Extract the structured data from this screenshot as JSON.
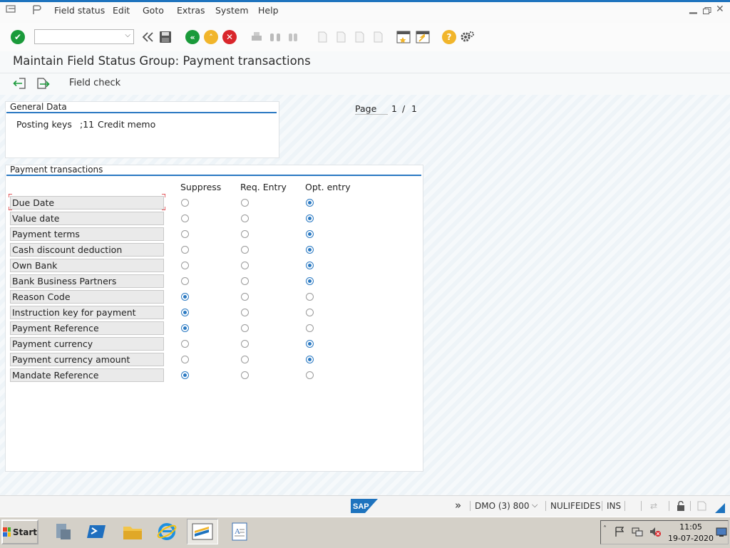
{
  "menu": {
    "items": [
      "Field status",
      "Edit",
      "Goto",
      "Extras",
      "System",
      "Help"
    ]
  },
  "toolbar": {
    "command_field_value": ""
  },
  "title": "Maintain Field Status Group: Payment transactions",
  "app_toolbar": {
    "field_check_label": "Field check"
  },
  "general_data": {
    "heading": "General Data",
    "posting_keys_label": "Posting keys",
    "posting_keys_value": ";11",
    "posting_keys_desc": "Credit memo"
  },
  "paging": {
    "label": "Page",
    "current": "1",
    "separator": "/",
    "total": "1"
  },
  "payment": {
    "heading": "Payment transactions",
    "columns": [
      "Suppress",
      "Req. Entry",
      "Opt. entry"
    ],
    "rows": [
      {
        "label": "Due Date",
        "selected": 2
      },
      {
        "label": "Value date",
        "selected": 2
      },
      {
        "label": "Payment terms",
        "selected": 2
      },
      {
        "label": "Cash discount deduction",
        "selected": 2
      },
      {
        "label": "Own Bank",
        "selected": 2
      },
      {
        "label": "Bank Business Partners",
        "selected": 2
      },
      {
        "label": "Reason Code",
        "selected": 0
      },
      {
        "label": "Instruction key for payment",
        "selected": 0
      },
      {
        "label": "Payment Reference",
        "selected": 0
      },
      {
        "label": "Payment currency",
        "selected": 2
      },
      {
        "label": "Payment currency amount",
        "selected": 2
      },
      {
        "label": "Mandate Reference",
        "selected": 0
      }
    ]
  },
  "status_bar": {
    "system": "DMO (3) 800",
    "user": "NULIFEIDES",
    "mode": "INS",
    "logo": "SAP"
  },
  "taskbar": {
    "start_label": "Start",
    "time": "11:05",
    "date": "19-07-2020"
  },
  "colors": {
    "accent": "#1e73be",
    "radio_selected": "#2a79c2",
    "enter_green": "#1a9a3a",
    "exit_yellow": "#f1b52b",
    "cancel_red": "#d9262b"
  }
}
